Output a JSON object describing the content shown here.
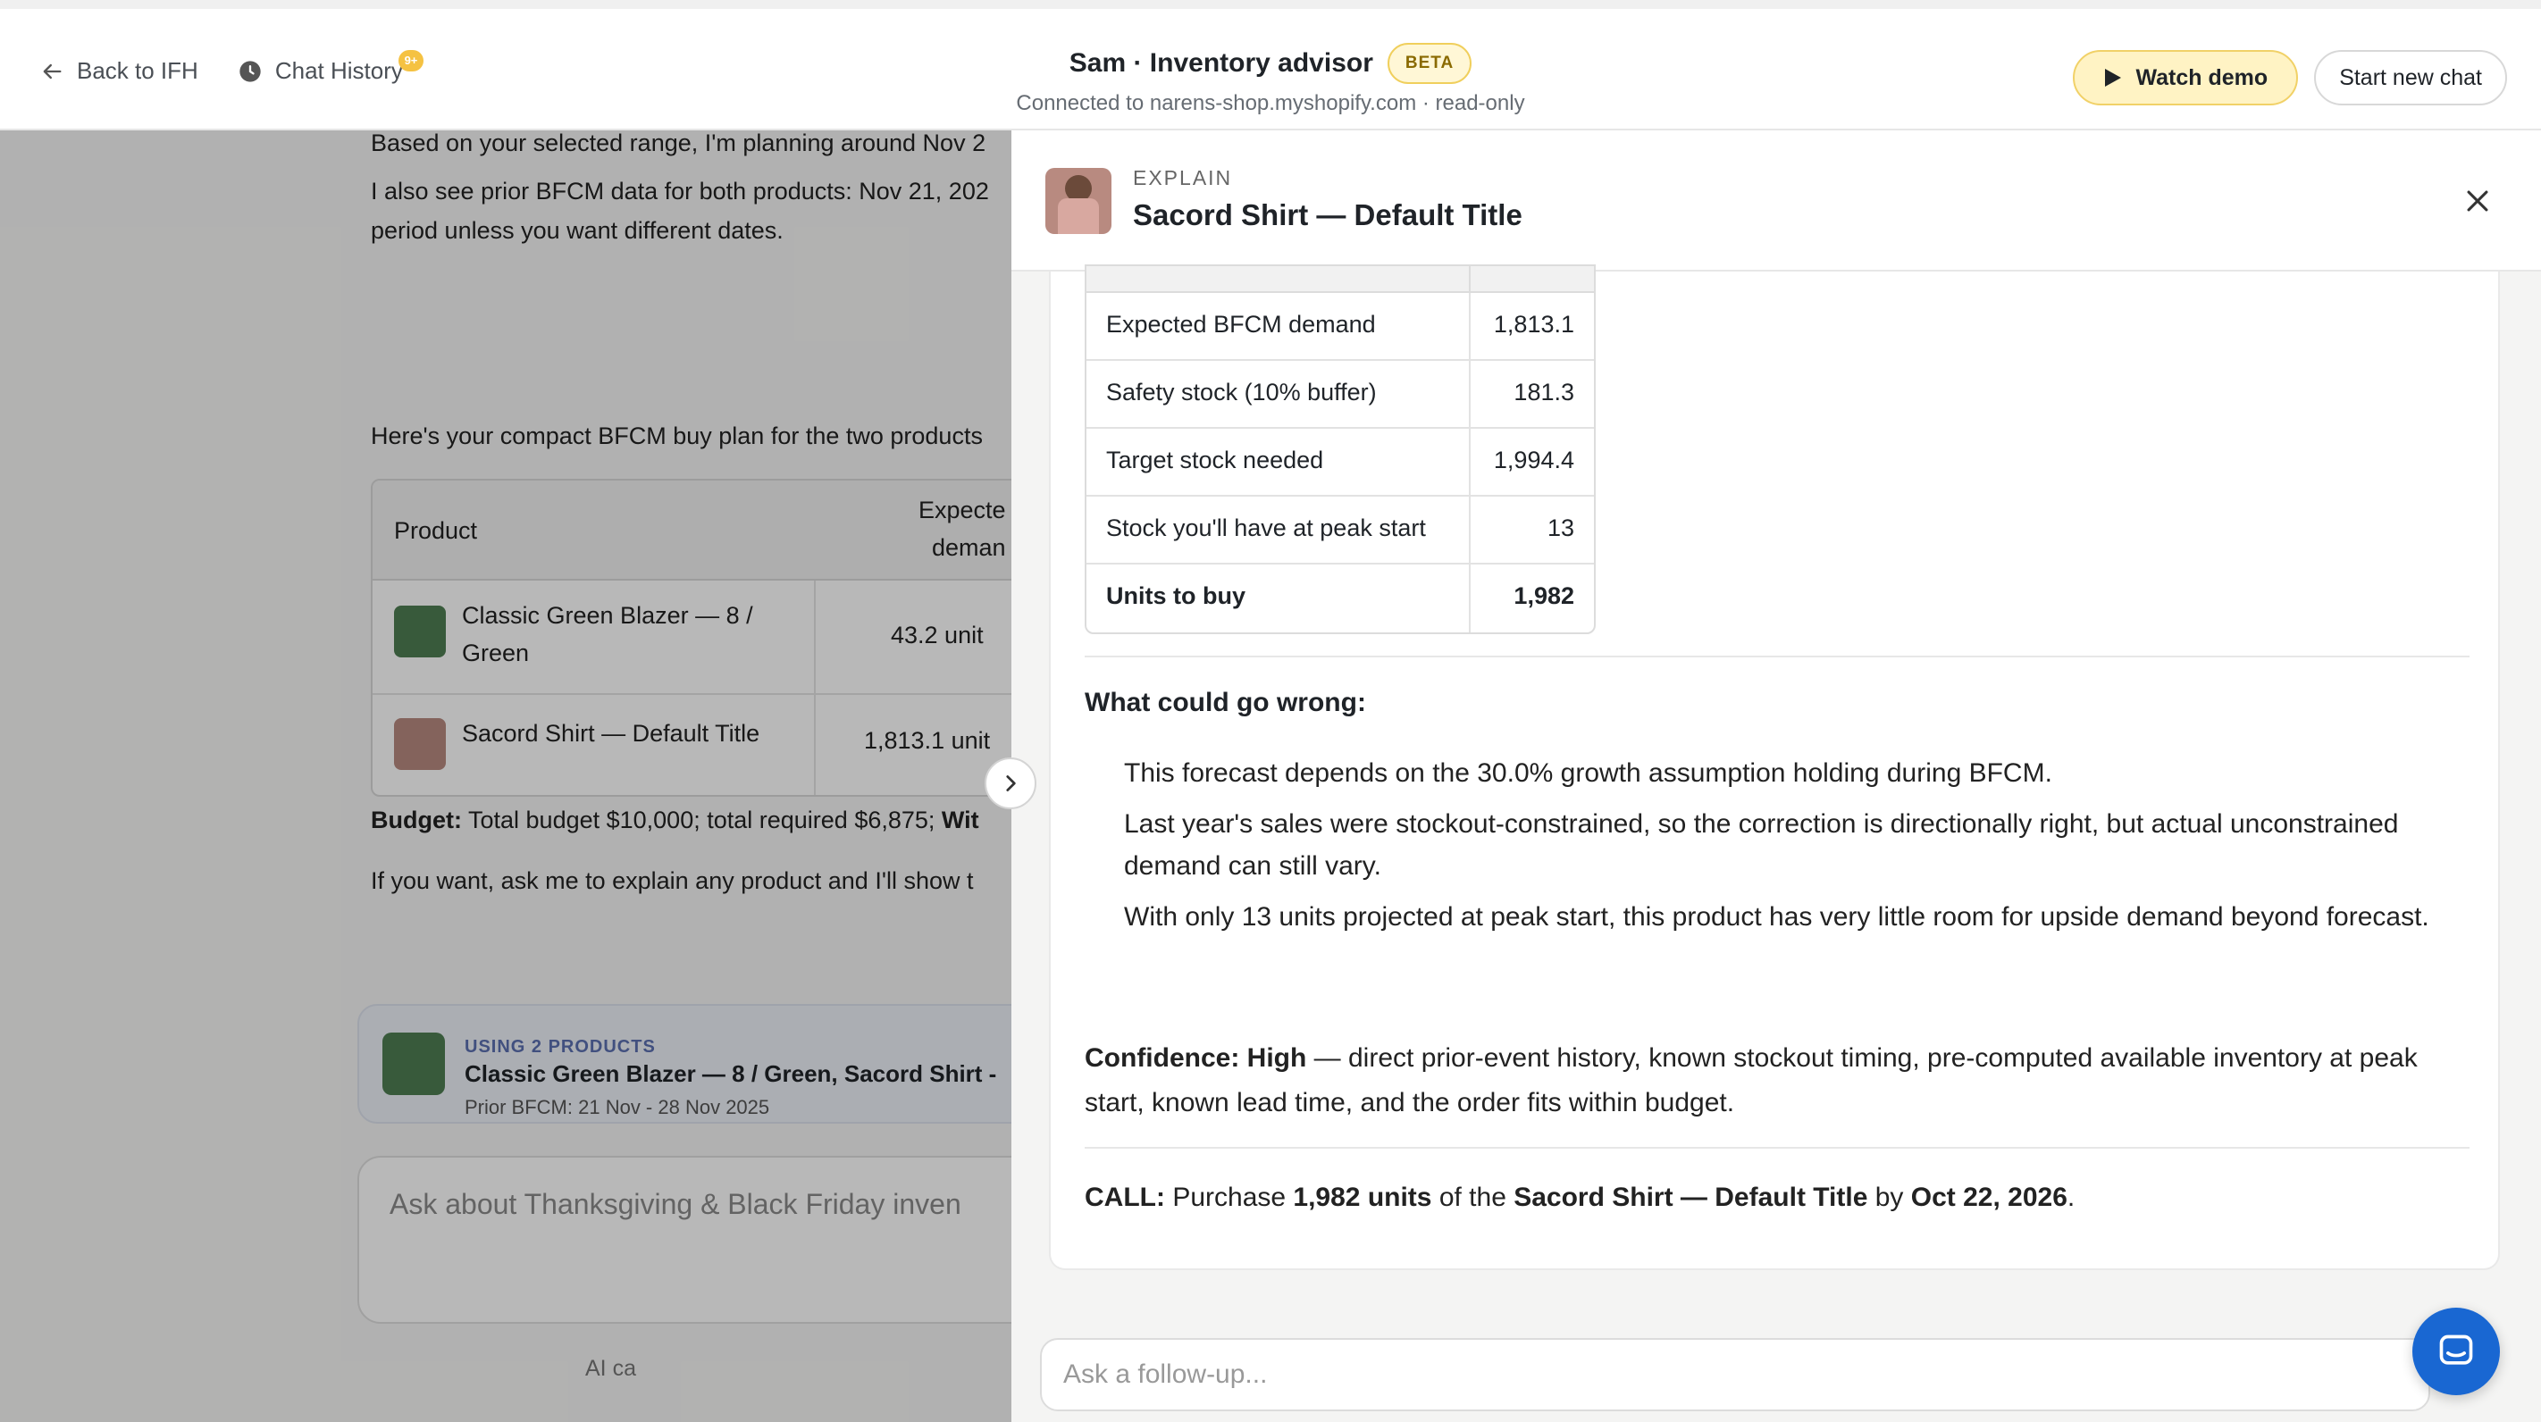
{
  "header": {
    "back_label": "Back to IFH",
    "history_label": "Chat History",
    "history_badge": "9+",
    "title": "Sam · Inventory advisor",
    "beta_label": "BETA",
    "subtitle": "Connected to narens-shop.myshopify.com · read-only",
    "watch_demo_label": "Watch demo",
    "new_chat_label": "Start new chat"
  },
  "chat": {
    "line1": "Based on your selected range, I'm planning around Nov 2",
    "line2a": "I also see prior BFCM data for both products: Nov 21, 202",
    "line2b": "period unless you want different dates.",
    "line3": "Here's your compact BFCM buy plan for the two products",
    "table": {
      "col_product": "Product",
      "col_expected_1": "Expecte",
      "col_expected_2": "deman",
      "rows": [
        {
          "name_1": "Classic Green Blazer — 8 /",
          "name_2": "Green",
          "value": "43.2 unit"
        },
        {
          "name_1": "Sacord Shirt — Default Title",
          "name_2": "",
          "value": "1,813.1 unit"
        }
      ]
    },
    "budget_label": "Budget:",
    "budget_text": " Total budget $10,000; total required $6,875; ",
    "budget_tail": "Wit",
    "explain_hint": "If you want, ask me to explain any product and I'll show t",
    "context": {
      "tag": "USING 2 PRODUCTS",
      "products": "Classic Green Blazer — 8 / Green, Sacord Shirt -",
      "prior": "Prior BFCM: 21 Nov - 28 Nov 2025"
    },
    "input_placeholder": "Ask about Thanksgiving & Black Friday inven",
    "disclaimer": "AI ca"
  },
  "panel": {
    "kicker": "EXPLAIN",
    "title": "Sacord Shirt — Default Title",
    "calc_rows": [
      {
        "label": "Expected BFCM demand",
        "value": "1,813.1"
      },
      {
        "label": "Safety stock (10% buffer)",
        "value": "181.3"
      },
      {
        "label": "Target stock needed",
        "value": "1,994.4"
      },
      {
        "label": "Stock you'll have at peak start",
        "value": "13"
      },
      {
        "label": "Units to buy",
        "value": "1,982"
      }
    ],
    "risks_heading": "What could go wrong:",
    "risks": [
      "This forecast depends on the 30.0% growth assumption holding during BFCM.",
      "Last year's sales were stockout-constrained, so the correction is directionally right, but actual unconstrained demand can still vary.",
      "With only 13 units projected at peak start, this product has very little room for upside demand beyond forecast."
    ],
    "confidence_label": "Confidence: High",
    "confidence_text": " — direct prior-event history, known stockout timing, pre-computed available inventory at peak start, known lead time, and the order fits within budget.",
    "call": {
      "label": "CALL:",
      "t1": " Purchase ",
      "units": "1,982 units",
      "t2": " of the ",
      "product": "Sacord Shirt — Default Title",
      "t3": " by ",
      "date": "Oct 22, 2026",
      "t4": "."
    },
    "followup_placeholder": "Ask a follow-up..."
  },
  "colors": {
    "accent_yellow": "#fff3c4",
    "beta_border": "#f0cf5c",
    "fab_blue": "#1967d2",
    "context_tag": "#5b6fb0"
  },
  "icons": {
    "back": "arrow-left-icon",
    "history": "clock-icon",
    "demo": "play-icon",
    "close": "close-icon",
    "expand": "chevron-right-icon",
    "messenger": "chat-bubble-icon"
  }
}
